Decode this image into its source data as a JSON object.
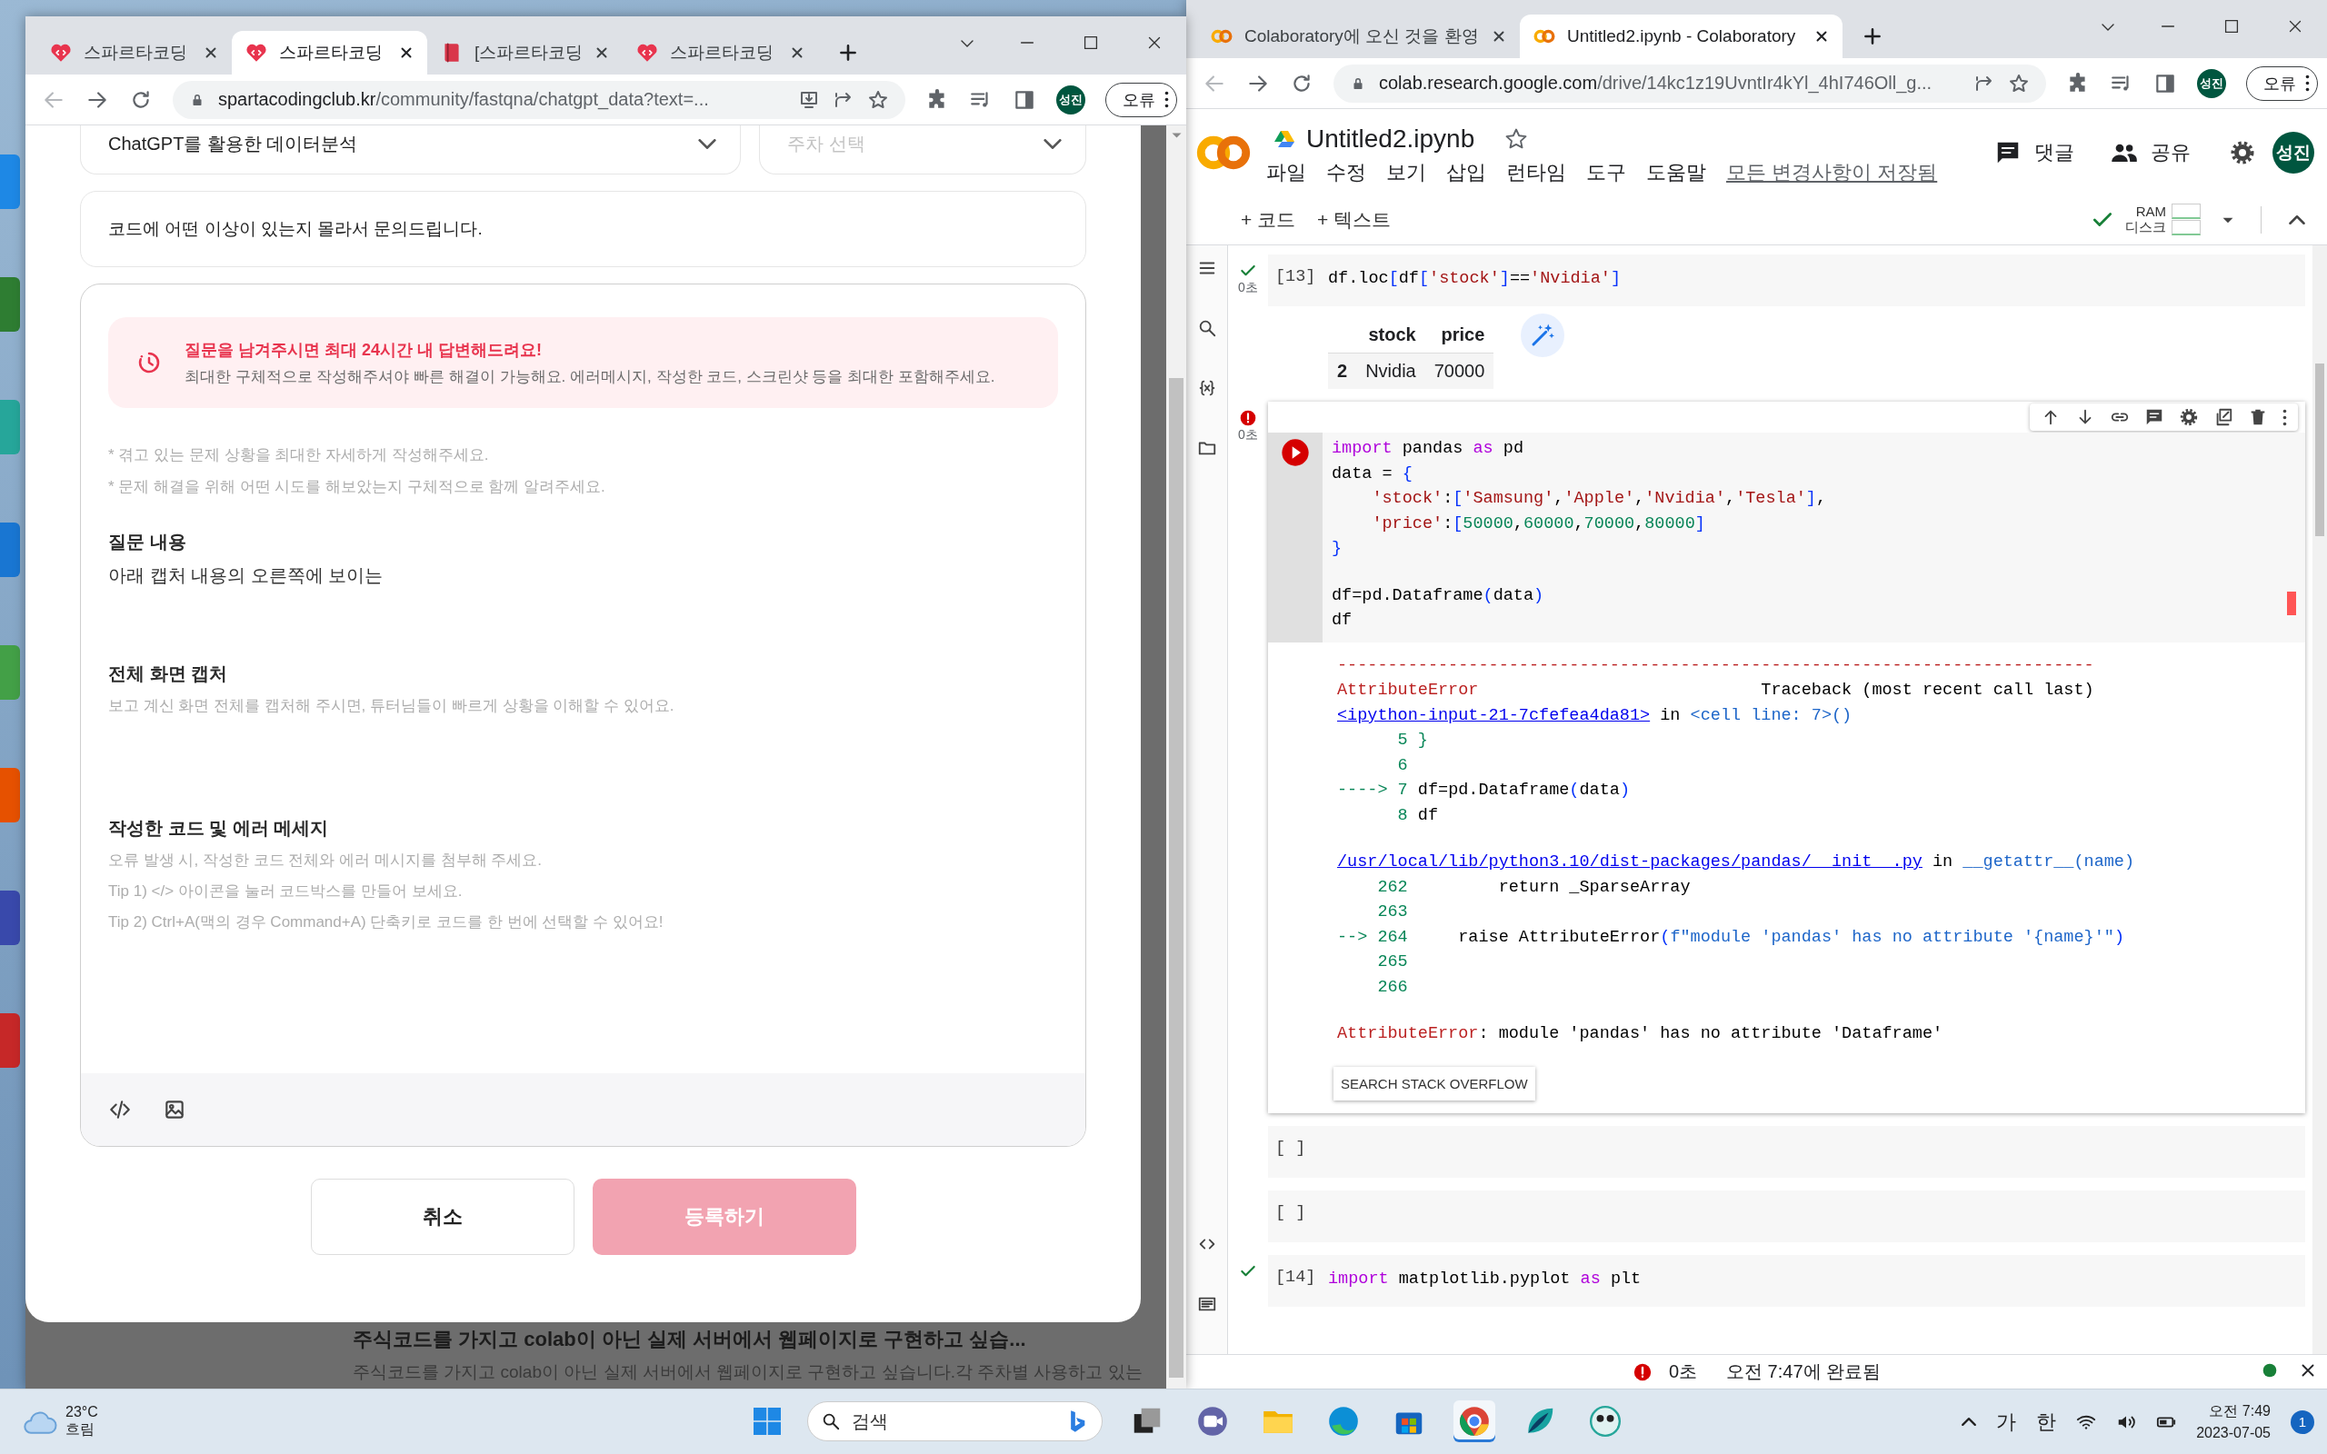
{
  "left_window": {
    "tabs": [
      {
        "title": "스파르타코딩",
        "kind": "sparta",
        "selected": false
      },
      {
        "title": "스파르타코딩",
        "kind": "sparta",
        "selected": true
      },
      {
        "title": "[스파르타코딩",
        "kind": "book",
        "selected": false
      },
      {
        "title": "스파르타코딩",
        "kind": "sparta",
        "selected": false
      }
    ],
    "url": {
      "host": "spartacodingclub.kr",
      "path": "/community/fastqna/chatgpt_data?text=..."
    },
    "profile": "성진",
    "error_button": "오류",
    "form": {
      "course_select": "ChatGPT를 활용한 데이터분석",
      "week_select": {
        "placeholder": "주차 선택"
      },
      "title_field": "코드에 어떤 이상이 있는지 몰라서 문의드립니다.",
      "notice": {
        "heading": "질문을 남겨주시면 최대 24시간 내 답변해드려요!",
        "body": "최대한 구체적으로 작성해주셔야 빠른 해결이 가능해요. 에러메시지, 작성한 코드, 스크린샷 등을 최대한 포함해주세요."
      },
      "hints": [
        "* 겪고 있는 문제 상황을 최대한 자세하게 작성해주세요.",
        "* 문제 해결을 위해 어떤 시도를 해보았는지 구체적으로 함께 알려주세요."
      ],
      "sections": [
        {
          "heading": "질문 내용",
          "kind": "answer",
          "lines": [
            "아래 캡처 내용의 오른쪽에 보이는"
          ]
        },
        {
          "heading": "전체 화면 캡처",
          "kind": "hint",
          "lines": [
            "보고 계신 화면 전체를 캡처해 주시면, 튜터님들이 빠르게 상황을 이해할 수 있어요."
          ]
        },
        {
          "heading": "작성한 코드 및 에러 메세지",
          "kind": "hint",
          "lines": [
            "오류 발생 시, 작성한 코드 전체와 에러 메시지를 첨부해 주세요.",
            "Tip 1) </> 아이콘을 눌러 코드박스를 만들어 보세요.",
            "Tip 2) Ctrl+A(맥의 경우 Command+A) 단축키로 코드를 한 번에 선택할 수 있어요!"
          ]
        }
      ],
      "cancel_button": "취소",
      "submit_button": {
        "label": "등록하기",
        "disabled": true
      }
    },
    "background_post": {
      "title": "주식코드를 가지고 colab이 아닌 실제 서버에서 웹페이지로 구현하고 싶습...",
      "snippet": "주식코드를 가지고 colab이 아닌 실제 서버에서 웹페이지로 구현하고 싶습니다.각 주차별 사용하고 있는"
    }
  },
  "right_window": {
    "tabs": [
      {
        "title": "Colaboratory에 오신 것을 환영",
        "selected": false
      },
      {
        "title": "Untitled2.ipynb - Colaboratory",
        "selected": true
      }
    ],
    "url": {
      "host": "colab.research.google.com",
      "path": "/drive/14kc1z19UvntIr4kYl_4hI746Oll_g..."
    },
    "profile": "성진",
    "error_button": "오류",
    "colab": {
      "filename": "Untitled2.ipynb",
      "starred": false,
      "menu": [
        "파일",
        "수정",
        "보기",
        "삽입",
        "런타임",
        "도구",
        "도움말"
      ],
      "save_status": "모든 변경사항이 저장됨",
      "comment_button": "댓글",
      "share_button": "공유",
      "avatar": "성진",
      "add_code": "+ 코드",
      "add_text": "+ 텍스트",
      "resources": {
        "ram_label": "RAM",
        "disk_label": "디스크",
        "connected": true
      },
      "cells": [
        {
          "exec": "[13]",
          "kind": "ok",
          "time": "0초",
          "focused": false,
          "code": [
            [
              [
                {
                  "text": "df.loc",
                  "kind": "pl"
                },
                {
                  "text": "[",
                  "kind": "br"
                },
                {
                  "text": "df",
                  "kind": "pl"
                },
                {
                  "text": "[",
                  "kind": "br"
                },
                {
                  "text": "'stock'",
                  "kind": "str"
                },
                {
                  "text": "]",
                  "kind": "br"
                },
                {
                  "text": "==",
                  "kind": "pl"
                },
                {
                  "text": "'Nvidia'",
                  "kind": "str"
                },
                {
                  "text": "]",
                  "kind": "br"
                }
              ]
            ]
          ],
          "output_table": {
            "columns": [
              "stock",
              "price"
            ],
            "rows": [
              {
                "index": "2",
                "cells": [
                  "Nvidia",
                  "70000"
                ]
              }
            ]
          }
        },
        {
          "kind": "error",
          "time": "0초",
          "focused": true,
          "code": [
            [
              [
                {
                  "text": "import",
                  "kind": "kw"
                },
                {
                  "text": " pandas ",
                  "kind": "pl"
                },
                {
                  "text": "as",
                  "kind": "kw"
                },
                {
                  "text": " pd",
                  "kind": "pl"
                }
              ],
              [
                {
                  "text": "data = ",
                  "kind": "pl"
                },
                {
                  "text": "{",
                  "kind": "br"
                }
              ],
              [
                {
                  "text": "    'stock'",
                  "kind": "str"
                },
                {
                  "text": ":",
                  "kind": "pl"
                },
                {
                  "text": "[",
                  "kind": "br"
                },
                {
                  "text": "'Samsung'",
                  "kind": "str"
                },
                {
                  "text": ",",
                  "kind": "pl"
                },
                {
                  "text": "'Apple'",
                  "kind": "str"
                },
                {
                  "text": ",",
                  "kind": "pl"
                },
                {
                  "text": "'Nvidia'",
                  "kind": "str"
                },
                {
                  "text": ",",
                  "kind": "pl"
                },
                {
                  "text": "'Tesla'",
                  "kind": "str"
                },
                {
                  "text": "]",
                  "kind": "br"
                },
                {
                  "text": ",",
                  "kind": "pl"
                }
              ],
              [
                {
                  "text": "    'price'",
                  "kind": "str"
                },
                {
                  "text": ":",
                  "kind": "pl"
                },
                {
                  "text": "[",
                  "kind": "br"
                },
                {
                  "text": "50000",
                  "kind": "num"
                },
                {
                  "text": ",",
                  "kind": "pl"
                },
                {
                  "text": "60000",
                  "kind": "num"
                },
                {
                  "text": ",",
                  "kind": "pl"
                },
                {
                  "text": "70000",
                  "kind": "num"
                },
                {
                  "text": ",",
                  "kind": "pl"
                },
                {
                  "text": "80000",
                  "kind": "num"
                },
                {
                  "text": "]",
                  "kind": "br"
                }
              ],
              [
                {
                  "text": "}",
                  "kind": "br"
                }
              ]
            ],
            [
              [
                {
                  "text": "df=pd.Dataframe",
                  "kind": "pl"
                },
                {
                  "text": "(",
                  "kind": "br"
                },
                {
                  "text": "data",
                  "kind": "pl"
                },
                {
                  "text": ")",
                  "kind": "br"
                }
              ],
              [
                {
                  "text": "df",
                  "kind": "pl"
                }
              ]
            ]
          ],
          "traceback": [
            [
              [
                {
                  "text": "---------------------------------------------------------------------------",
                  "kind": "err"
                }
              ],
              [
                {
                  "text": "AttributeError",
                  "kind": "err"
                },
                {
                  "text": "                            Traceback (most recent call last)",
                  "kind": "pl"
                }
              ],
              [
                {
                  "text": "<ipython-input-21-7cfefea4da81>",
                  "kind": "link"
                },
                {
                  "text": " in ",
                  "kind": "pl"
                },
                {
                  "text": "<cell line: 7>()",
                  "kind": "fn"
                }
              ],
              [
                {
                  "text": "      5 }",
                  "kind": "num"
                }
              ],
              [
                {
                  "text": "      6",
                  "kind": "num"
                }
              ],
              [
                {
                  "text": "----> 7 ",
                  "kind": "num"
                },
                {
                  "text": "df=pd.Dataframe",
                  "kind": "pl"
                },
                {
                  "text": "(",
                  "kind": "br"
                },
                {
                  "text": "data",
                  "kind": "pl"
                },
                {
                  "text": ")",
                  "kind": "br"
                }
              ],
              [
                {
                  "text": "      8 ",
                  "kind": "num"
                },
                {
                  "text": "df",
                  "kind": "pl"
                }
              ]
            ],
            [
              [
                {
                  "text": "/usr/local/lib/python3.10/dist-packages/pandas/__init__.py",
                  "kind": "link"
                },
                {
                  "text": " in ",
                  "kind": "pl"
                },
                {
                  "text": "__getattr__(name)",
                  "kind": "fn"
                }
              ],
              [
                {
                  "text": "    262 ",
                  "kind": "num"
                },
                {
                  "text": "        return _SparseArray",
                  "kind": "pl"
                }
              ],
              [
                {
                  "text": "    263",
                  "kind": "num"
                }
              ],
              [
                {
                  "text": "--> 264 ",
                  "kind": "num"
                },
                {
                  "text": "    raise AttributeError",
                  "kind": "pl"
                },
                {
                  "text": "(",
                  "kind": "br"
                },
                {
                  "text": "f\"module 'pandas' has no attribute '{name}'\"",
                  "kind": "fn"
                },
                {
                  "text": ")",
                  "kind": "br"
                }
              ],
              [
                {
                  "text": "    265",
                  "kind": "num"
                }
              ],
              [
                {
                  "text": "    266",
                  "kind": "num"
                }
              ]
            ],
            [
              [
                {
                  "text": "AttributeError",
                  "kind": "err"
                },
                {
                  "text": ": module 'pandas' has no attribute 'Dataframe'",
                  "kind": "pl"
                }
              ]
            ]
          ],
          "search_button": "SEARCH STACK OVERFLOW"
        },
        {
          "exec": "[ ]",
          "kind": "idle",
          "focused": false
        },
        {
          "exec": "[ ]",
          "kind": "idle",
          "focused": false
        },
        {
          "exec": "[14]",
          "kind": "ok",
          "focused": false,
          "code": [
            [
              [
                {
                  "text": "import",
                  "kind": "kw"
                },
                {
                  "text": " matplotlib.pyplot ",
                  "kind": "pl"
                },
                {
                  "text": "as",
                  "kind": "kw"
                },
                {
                  "text": " plt",
                  "kind": "pl"
                }
              ]
            ]
          ]
        }
      ],
      "status_bar": {
        "kind": "error",
        "time": "0초",
        "message": "오전 7:47에 완료됨"
      }
    }
  },
  "taskbar": {
    "weather": {
      "temperature": "23°C",
      "condition": "흐림"
    },
    "search": {
      "placeholder": "검색"
    },
    "apps": [
      {
        "active": false
      },
      {
        "active": false
      },
      {
        "active": false
      },
      {
        "active": false
      },
      {
        "active": false
      },
      {
        "active": true
      },
      {
        "active": false
      },
      {
        "active": false
      }
    ],
    "ime": [
      "가",
      "한"
    ],
    "clock": {
      "time": "오전 7:49",
      "date": "2023-07-05"
    },
    "notifications": "1"
  }
}
